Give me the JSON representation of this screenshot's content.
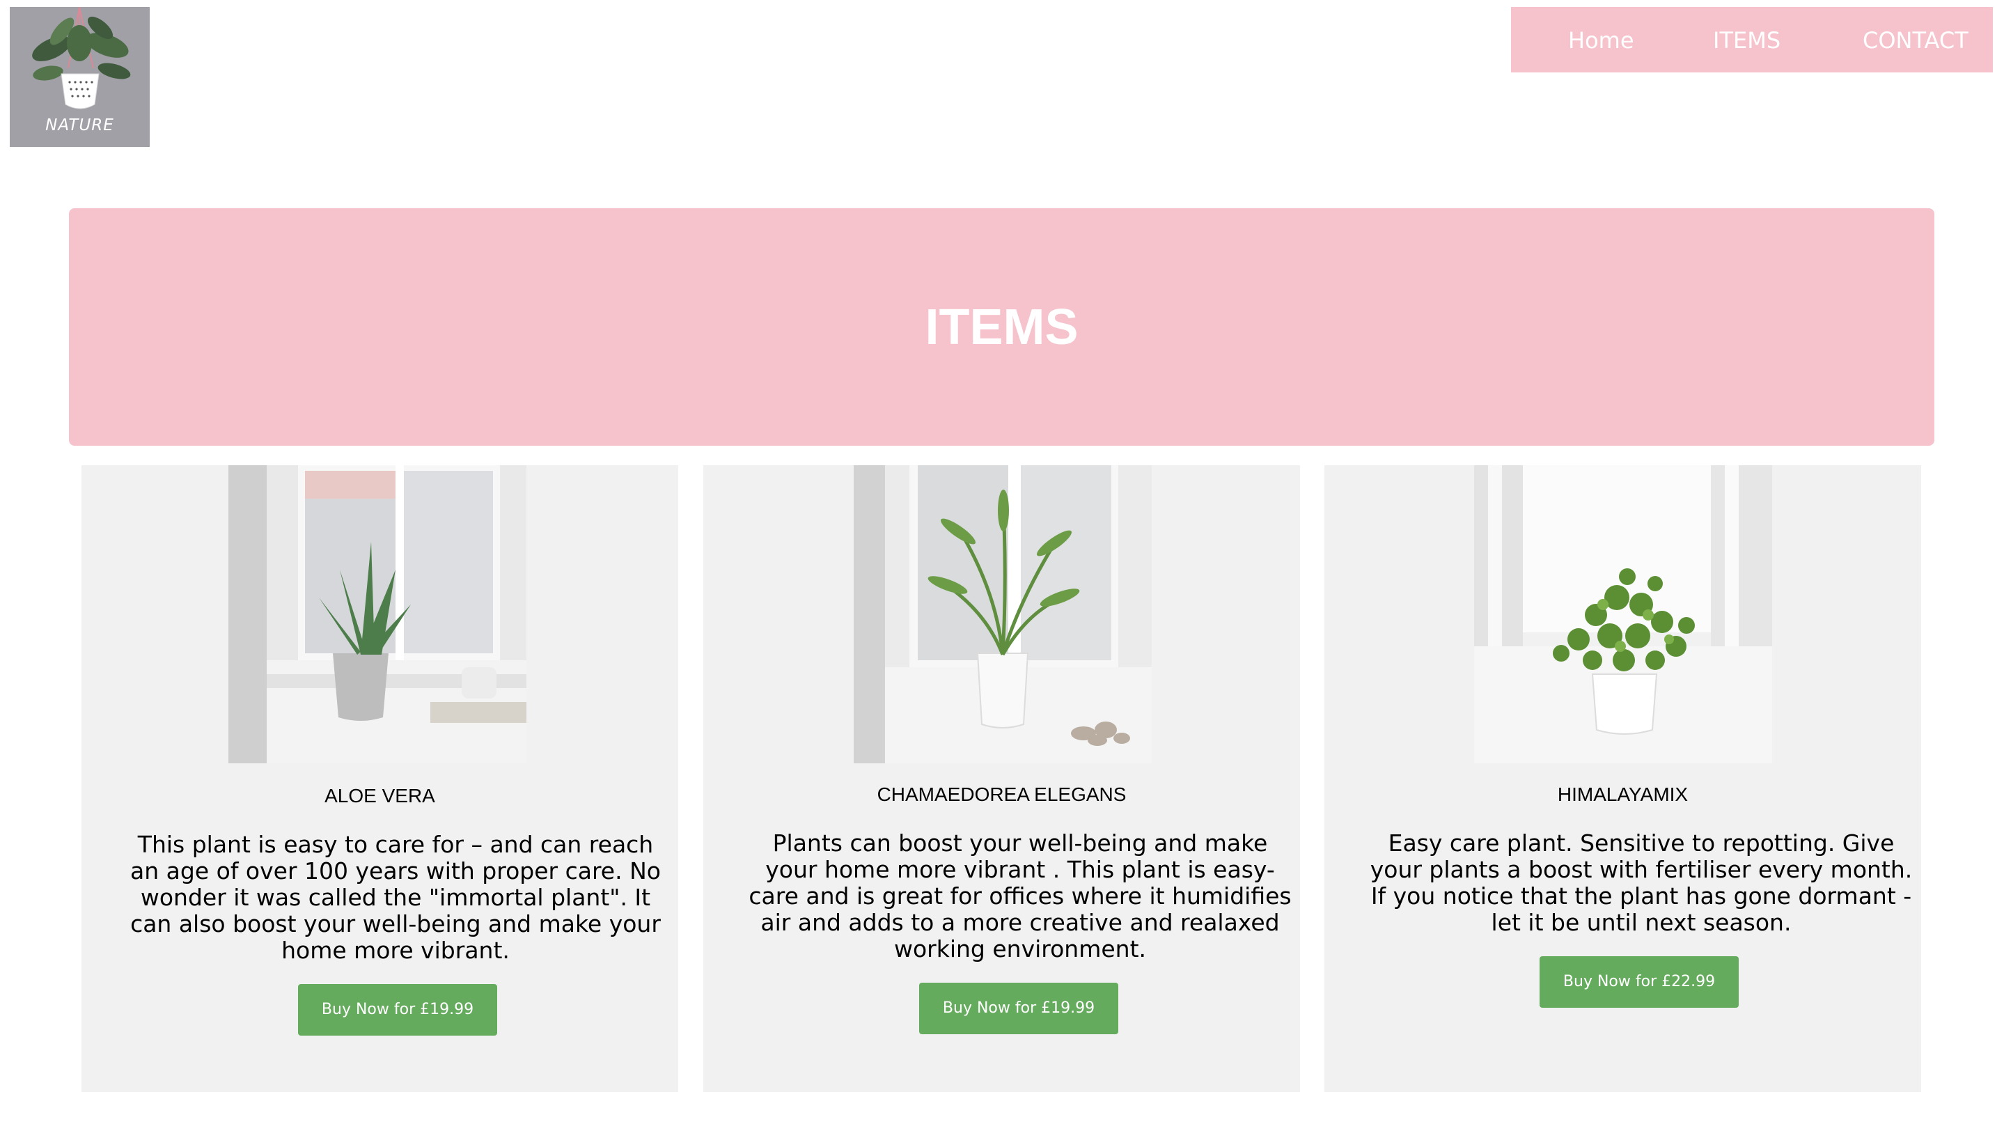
{
  "logo": {
    "text": "NATURE",
    "icon": "hanging-plant-icon"
  },
  "nav": {
    "items": [
      {
        "label": "Home"
      },
      {
        "label": "ITEMS"
      },
      {
        "label": "CONTACT"
      }
    ]
  },
  "banner": {
    "title": "ITEMS"
  },
  "products": [
    {
      "name": "ALOE VERA",
      "description": "This plant is easy to care for – and can reach an age of over 100 years with proper care. No wonder it was called the \"immortal plant\". It can also boost your well-being and make your home more vibrant.",
      "button": "Buy Now for £19.99",
      "image": "aloe-vera-plant-photo"
    },
    {
      "name": "CHAMAEDOREA ELEGANS",
      "description": "Plants can boost your well-being and make your home more vibrant . This plant is easy-care and is great for offices where it humidifies air and adds to a more creative and realaxed working environment.",
      "button": "Buy Now for £19.99",
      "image": "chamaedorea-palm-photo"
    },
    {
      "name": "HIMALAYAMIX",
      "description": "Easy care plant. Sensitive to repotting. Give your plants a boost with fertiliser every month. If you notice that the plant has gone dormant - let it be until next season.",
      "button": "Buy Now for £22.99",
      "image": "himalayamix-plant-photo"
    }
  ],
  "colors": {
    "accent_pink": "#f6c3cc",
    "button_green": "#65ab5d",
    "card_bg": "#f1f1f1",
    "logo_bg": "#a1a0a7"
  }
}
